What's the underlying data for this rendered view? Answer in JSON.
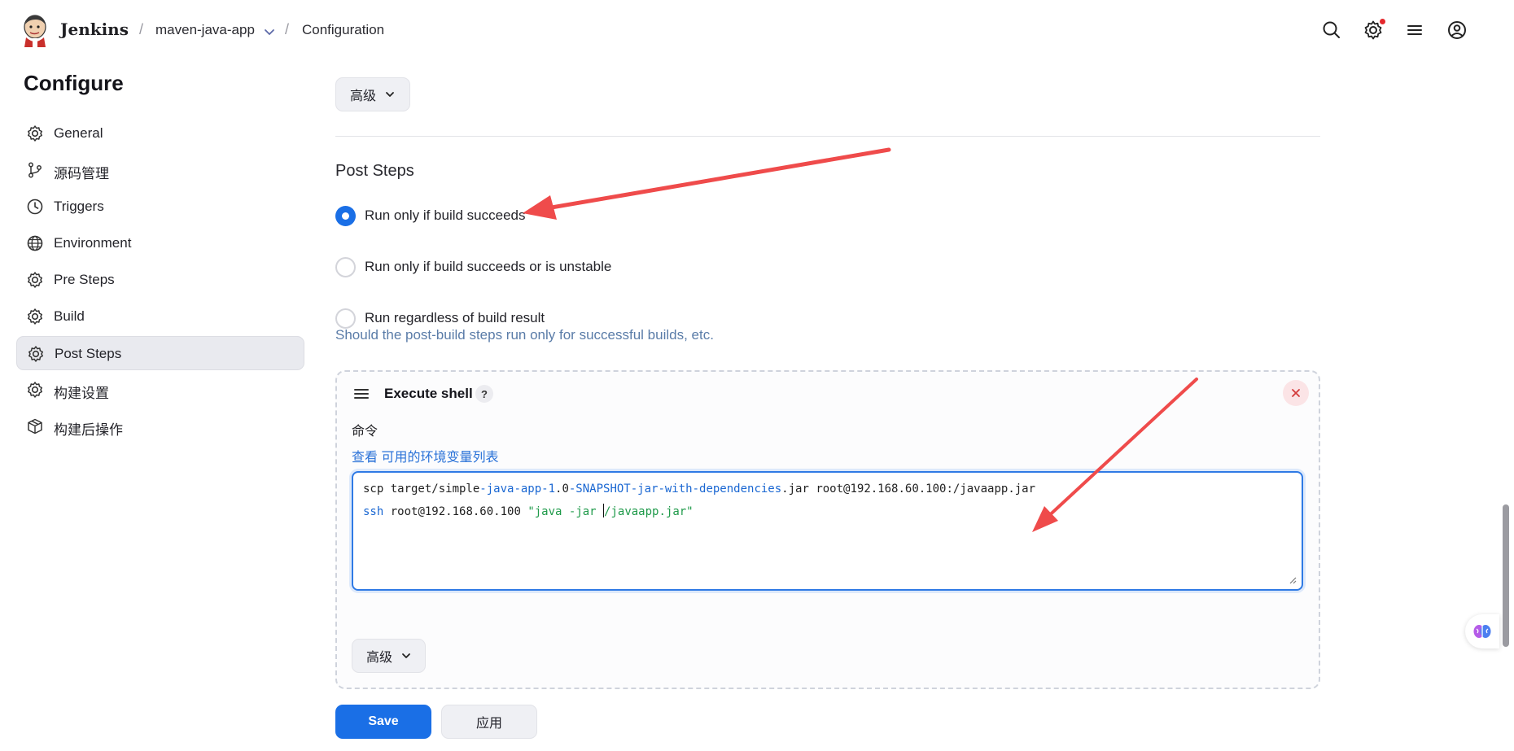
{
  "header": {
    "brand": "Jenkins",
    "breadcrumb": [
      "maven-java-app",
      "Configuration"
    ],
    "separator": "/",
    "icons": [
      "search-icon",
      "manage-jenkins-gear-icon",
      "menu-icon",
      "user-account-icon"
    ],
    "notification_color": "#e5282d"
  },
  "sidebar": {
    "title": "Configure",
    "items": [
      {
        "label": "General",
        "icon": "gear-icon"
      },
      {
        "label": "源码管理",
        "icon": "branch-icon"
      },
      {
        "label": "Triggers",
        "icon": "clock-icon"
      },
      {
        "label": "Environment",
        "icon": "globe-icon"
      },
      {
        "label": "Pre Steps",
        "icon": "gear-icon"
      },
      {
        "label": "Build",
        "icon": "gear-icon"
      },
      {
        "label": "Post Steps",
        "icon": "gear-icon",
        "active": true
      },
      {
        "label": "构建设置",
        "icon": "gear-icon"
      },
      {
        "label": "构建后操作",
        "icon": "package-icon"
      }
    ]
  },
  "main": {
    "advanced_label": "高级",
    "post_steps": {
      "title": "Post Steps",
      "options": [
        {
          "label": "Run only if build succeeds",
          "checked": true
        },
        {
          "label": "Run only if build succeeds or is unstable",
          "checked": false
        },
        {
          "label": "Run regardless of build result",
          "checked": false
        }
      ],
      "helper": "Should the post-build steps run only for successful builds, etc."
    },
    "execute_shell": {
      "title": "Execute shell",
      "help": "?",
      "command_label": "命令",
      "env_link_prefix": "查看",
      "env_link": "可用的环境变量列表",
      "code": {
        "line1": {
          "a": "scp target/simple",
          "b": "-java-app-1",
          "c": ".0",
          "d": "-SNAPSHOT-jar-with-dependencies",
          "e": ".jar root@192.168.60.100:/javaapp.jar"
        },
        "line2": {
          "a": "ssh",
          "b": " root@192.168.60.100 ",
          "c": "\"java -jar ",
          "d": "/javaapp.jar\""
        }
      },
      "advanced_label": "高级"
    },
    "save_label": "Save",
    "apply_label": "应用"
  },
  "colors": {
    "primary": "#1a6fe6",
    "annotation_arrow": "#ef4b4b",
    "link": "#2a72d8"
  }
}
